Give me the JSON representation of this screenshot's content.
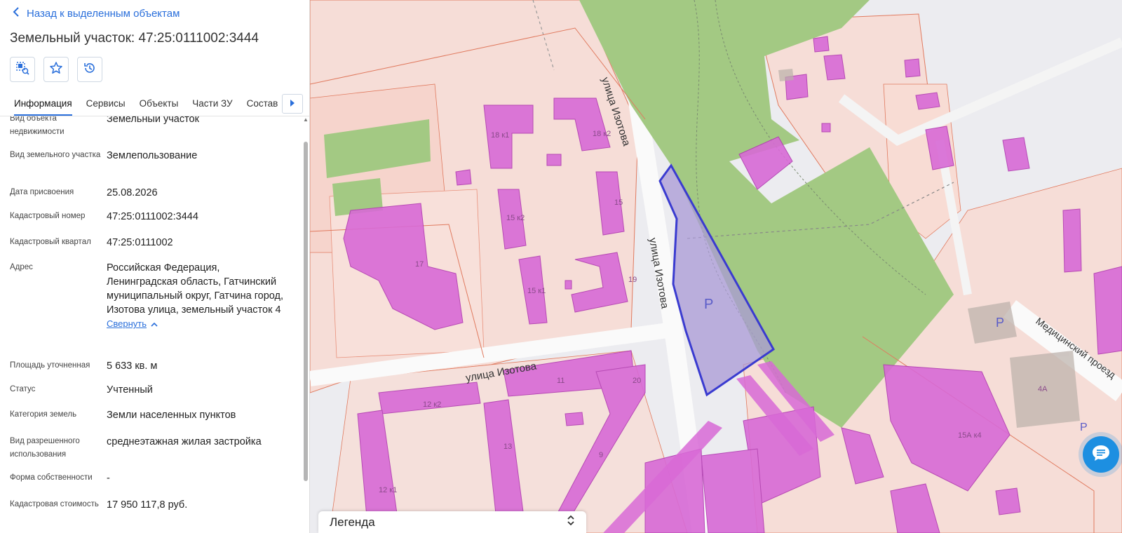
{
  "nav": {
    "back_label": "Назад к выделенным объектам"
  },
  "header": {
    "title": "Земельный участок: 47:25:0111002:3444"
  },
  "toolbar": {
    "icons": [
      "select-area-icon",
      "star-icon",
      "history-icon"
    ]
  },
  "tabs": [
    {
      "label": "Информация",
      "active": true
    },
    {
      "label": "Сервисы"
    },
    {
      "label": "Объекты"
    },
    {
      "label": "Части ЗУ"
    },
    {
      "label": "Состав"
    }
  ],
  "info": {
    "object_type": {
      "label": "Вид объекта недвижимости",
      "value": "Земельный участок"
    },
    "land_type": {
      "label": "Вид земельного участка",
      "value": "Землепользование"
    },
    "assign_date": {
      "label": "Дата присвоения",
      "value": "25.08.2026"
    },
    "cadastral_number": {
      "label": "Кадастровый номер",
      "value": "47:25:0111002:3444"
    },
    "cadastral_block": {
      "label": "Кадастровый квартал",
      "value": "47:25:0111002"
    },
    "address": {
      "label": "Адрес",
      "value": "Российская Федерация, Ленинградская область, Гатчинский муниципальный округ, Гатчина город, Изотова улица, земельный участок 4",
      "collapse_label": "Свернуть"
    },
    "area": {
      "label": "Площадь уточненная",
      "value": "5 633 кв. м"
    },
    "status": {
      "label": "Статус",
      "value": "Учтенный"
    },
    "land_category": {
      "label": "Категория земель",
      "value": "Земли населенных пунктов"
    },
    "permitted_use": {
      "label": "Вид разрешенного использования",
      "value": "среднеэтажная жилая застройка"
    },
    "ownership": {
      "label": "Форма собственности",
      "value": "-"
    },
    "cadastral_value": {
      "label": "Кадастровая стоимость",
      "value": "17 950 117,8 руб."
    }
  },
  "map": {
    "street_labels": [
      "улица Изотова",
      "улица Изотова",
      "улица Изотова",
      "Медицинский проезд"
    ],
    "building_numbers": [
      "18 к1",
      "18 к2",
      "15 к2",
      "15",
      "17",
      "15 к1",
      "19",
      "11",
      "20",
      "12 к2",
      "13",
      "9",
      "12 к1",
      "4А",
      "15А к4"
    ],
    "parking_labels": [
      "P",
      "P",
      "P"
    ],
    "colors": {
      "parcel_fill": "#a99ad6",
      "parcel_stroke": "#3a3bd0",
      "greenery": "#a3c983",
      "building": "#d86ad6",
      "lot": "#f6dcd6"
    }
  },
  "legend": {
    "label": "Легенда"
  }
}
